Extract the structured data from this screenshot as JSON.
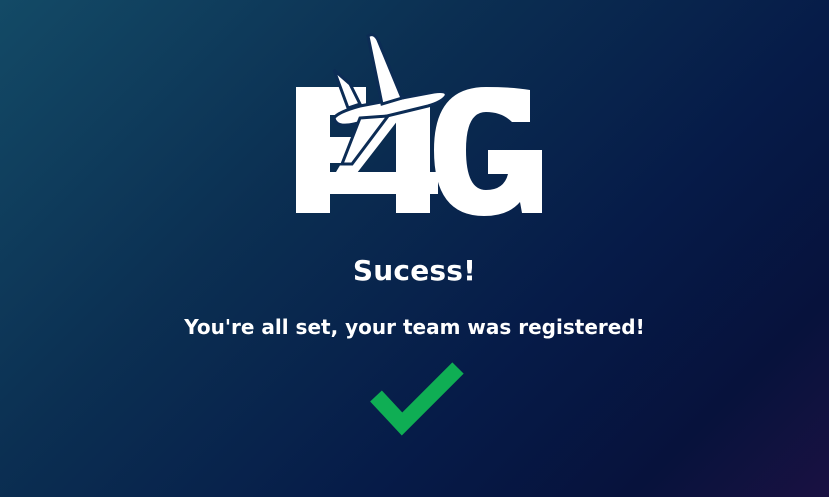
{
  "logo": {
    "text": "F4G",
    "icon": "airplane-icon",
    "color": "#ffffff"
  },
  "status": {
    "title": "Sucess!",
    "message": "You're all set, your team was registered!"
  },
  "checkmark": {
    "icon": "checkmark-icon",
    "color": "#0fae54"
  },
  "colors": {
    "background_top_left": "#134a66",
    "background_bottom_right": "#07123c",
    "text": "#ffffff"
  }
}
